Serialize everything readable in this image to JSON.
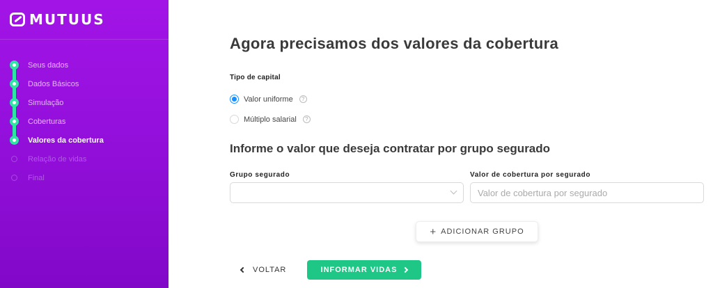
{
  "brand": {
    "name": "MUTUUS"
  },
  "sidebar": {
    "steps": [
      {
        "label": "Seus dados",
        "state": "done"
      },
      {
        "label": "Dados Básicos",
        "state": "done"
      },
      {
        "label": "Simulação",
        "state": "done"
      },
      {
        "label": "Coberturas",
        "state": "done"
      },
      {
        "label": "Valores da cobertura",
        "state": "current"
      },
      {
        "label": "Relação de vidas",
        "state": "pending"
      },
      {
        "label": "Final",
        "state": "pending"
      }
    ]
  },
  "main": {
    "title": "Agora precisamos dos valores da cobertura",
    "capital": {
      "label": "Tipo de capital",
      "options": [
        {
          "label": "Valor uniforme",
          "selected": true
        },
        {
          "label": "Múltiplo salarial",
          "selected": false
        }
      ],
      "help_glyph": "?"
    },
    "subtitle": "Informe o valor que deseja contratar por grupo segurado",
    "group_field": {
      "label": "Grupo segurado",
      "value": ""
    },
    "coverage_field": {
      "label": "Valor de cobertura por segurado",
      "placeholder": "Valor de cobertura por segurado",
      "value": ""
    },
    "add_group_button": {
      "icon": "+",
      "label": "ADICIONAR GRUPO"
    },
    "back_button": {
      "label": "VOLTAR"
    },
    "next_button": {
      "label": "INFORMAR VIDAS"
    }
  },
  "colors": {
    "sidebar_start": "#a214e6",
    "sidebar_end": "#8208c8",
    "step_done": "#2ee6a3",
    "primary_green": "#1fc787",
    "radio_blue": "#1890ff"
  },
  "icons": {
    "logo": "mutuus-logo-icon",
    "help": "help-circle-icon",
    "select": "chevron-down-icon",
    "add": "plus-icon",
    "back": "chevron-left-icon",
    "next": "chevron-right-icon"
  }
}
